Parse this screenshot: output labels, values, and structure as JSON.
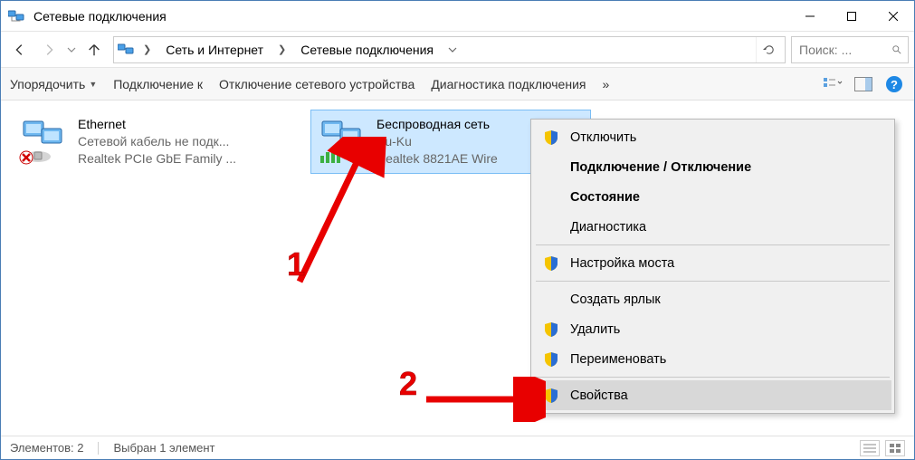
{
  "window": {
    "title": "Сетевые подключения"
  },
  "breadcrumb": {
    "item1": "Сеть и Интернет",
    "item2": "Сетевые подключения"
  },
  "search": {
    "placeholder": "Поиск: ..."
  },
  "toolbar": {
    "organize": "Упорядочить",
    "connect_to": "Подключение к",
    "disable_device": "Отключение сетевого устройства",
    "diagnose": "Диагностика подключения",
    "more": "»"
  },
  "items": [
    {
      "name": "Ethernet",
      "status": "Сетевой кабель не подк...",
      "device": "Realtek PCIe GbE Family ..."
    },
    {
      "name": "Беспроводная сеть",
      "status": "Ku-Ku",
      "device": "Realtek 8821AE Wire"
    }
  ],
  "context_menu": {
    "disable": "Отключить",
    "connect_disconnect": "Подключение / Отключение",
    "status": "Состояние",
    "diagnostics": "Диагностика",
    "bridge": "Настройка моста",
    "shortcut": "Создать ярлык",
    "delete": "Удалить",
    "rename": "Переименовать",
    "properties": "Свойства"
  },
  "statusbar": {
    "count_label": "Элементов: 2",
    "selection_label": "Выбран 1 элемент"
  },
  "annotations": {
    "n1": "1",
    "n2": "2"
  }
}
